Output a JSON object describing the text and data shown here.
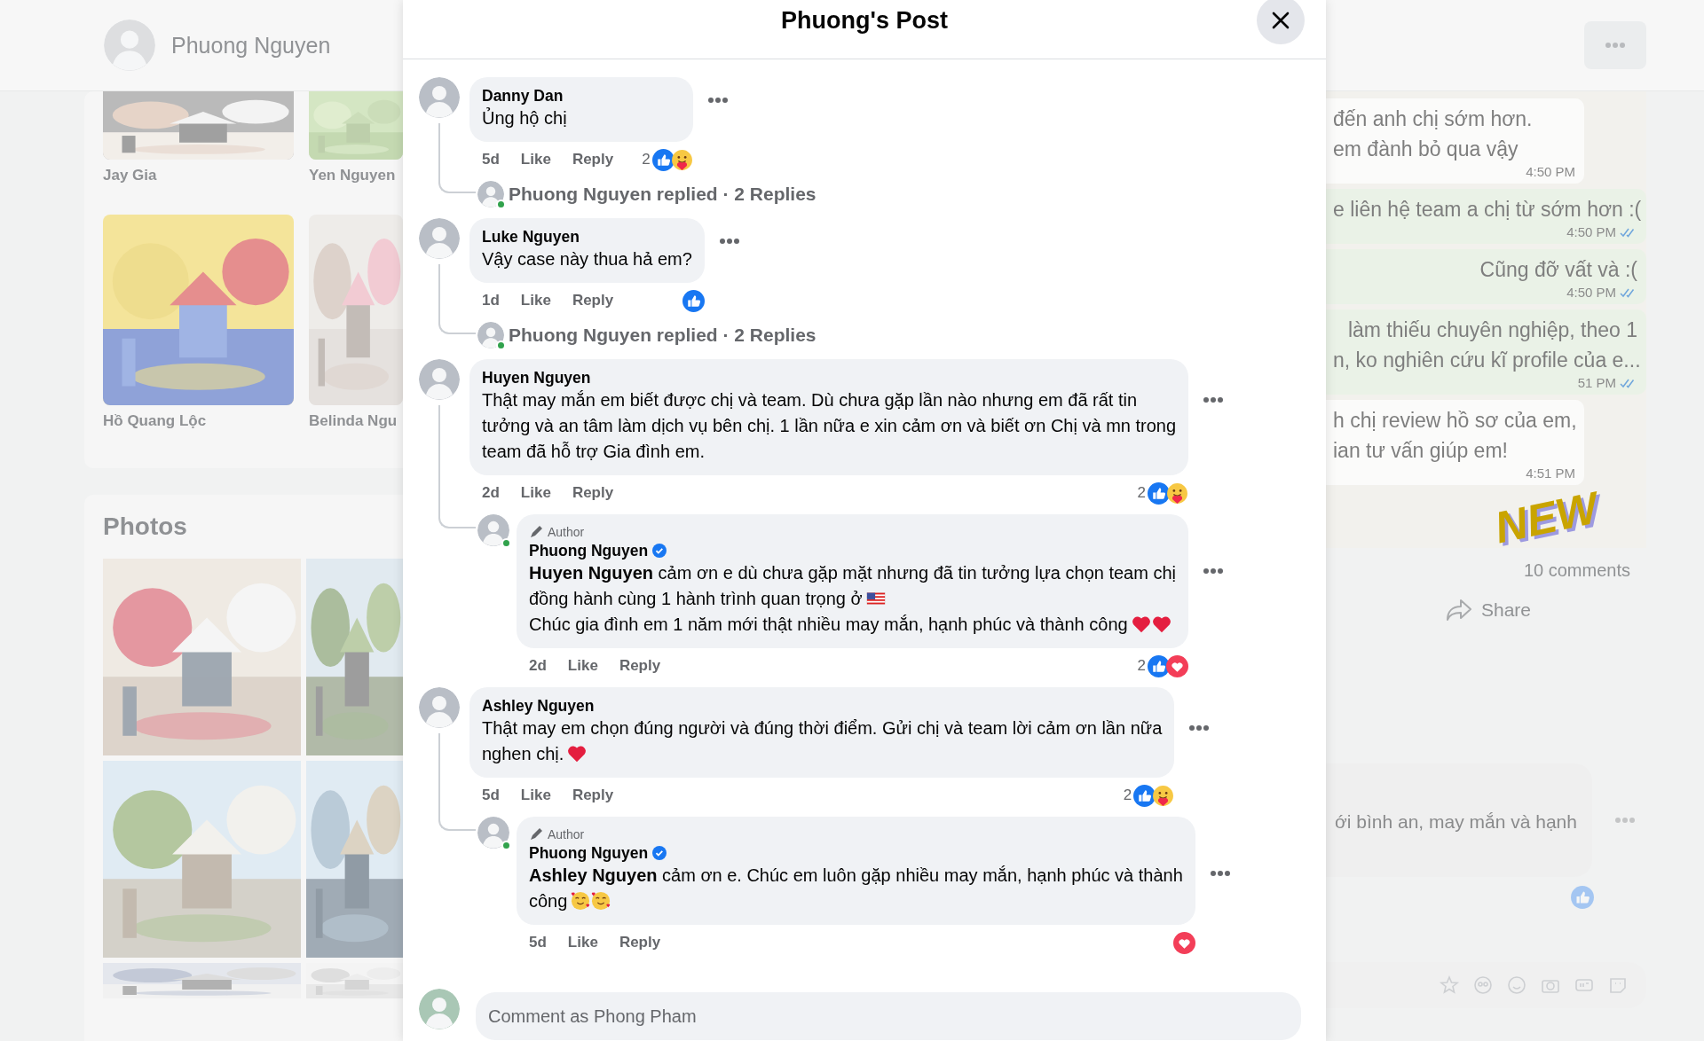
{
  "background": {
    "profile_name": "Phuong Nguyen",
    "friends": [
      {
        "name": "Jay Gia"
      },
      {
        "name": "Yen Nguyen"
      },
      {
        "name": "Hồ Quang Lộc"
      },
      {
        "name": "Belinda Ngu"
      }
    ],
    "photos_title": "Photos",
    "post": {
      "chat": [
        {
          "kind": "incoming",
          "lines": [
            "đến anh chị sớm hơn.",
            "em đành bỏ qua vậy"
          ],
          "time": "4:50 PM"
        },
        {
          "kind": "outgoing",
          "lines": [
            "e liên hệ team a chị từ sớm hơn :("
          ],
          "time": "4:50 PM",
          "read": true
        },
        {
          "kind": "outgoing",
          "lines": [
            "Cũng đỡ vất và :("
          ],
          "time": "4:50 PM",
          "read": true
        },
        {
          "kind": "outgoing",
          "lines": [
            "làm thiếu chuyên nghiệp, theo 1",
            "n, ko nghiên cứu kĩ profile của e..."
          ],
          "time": "51 PM",
          "read": true
        },
        {
          "kind": "incoming",
          "lines": [
            "h chị review hồ sơ của em,",
            "ian tư vấn giúp em!"
          ],
          "time": "4:51 PM"
        }
      ],
      "sticker": "NEW",
      "comment_count": "10 comments",
      "share": "Share",
      "comment_text": "ới bình an, may mắn và hạnh"
    }
  },
  "dialog": {
    "title": "Phuong's Post",
    "comments": [
      {
        "author": "Danny Dan",
        "lines": [
          {
            "text": "Ủng hộ chị"
          }
        ],
        "time": "5d",
        "like": "Like",
        "reply": "Reply",
        "reactions": {
          "count": "2",
          "items": [
            {
              "kind": "like"
            },
            {
              "kind": "care"
            }
          ]
        },
        "replied": {
          "text": "Phuong Nguyen replied · 2 Replies",
          "online": true
        }
      },
      {
        "author": "Luke Nguyen",
        "lines": [
          {
            "text": "Vậy case này thua hả em?"
          }
        ],
        "time": "1d",
        "like": "Like",
        "reply": "Reply",
        "reactions": {
          "items": [
            {
              "kind": "like"
            }
          ]
        },
        "replied": {
          "text": "Phuong Nguyen replied · 2 Replies",
          "online": true
        }
      },
      {
        "author": "Huyen Nguyen",
        "lines": [
          {
            "text": "Thật may mắn em biết được chị và team. Dù chưa gặp lần nào nhưng em đã rất tin"
          },
          {
            "text": "tưởng và an tâm làm dịch vụ bên chị. 1 lần nữa e xin cảm ơn và biết ơn Chị và mn trong"
          },
          {
            "text": "team đã hỗ trợ Gia đình em."
          }
        ],
        "time": "2d",
        "like": "Like",
        "reply": "Reply",
        "reactions": {
          "count": "2",
          "items": [
            {
              "kind": "like"
            },
            {
              "kind": "care"
            }
          ]
        },
        "replies": [
          {
            "badge": "Author",
            "author": "Phuong Nguyen",
            "verified": true,
            "online": true,
            "lines": [
              {
                "text": "**Huyen Nguyen** cảm ơn e dù chưa gặp mặt nhưng đã tin tưởng lựa chọn team chị"
              },
              {
                "text": "đồng hành cùng 1 hành trình quan trọng ở",
                "emojis": [
                  {
                    "kind": "flag"
                  }
                ]
              },
              {
                "text": "Chúc gia đình em 1 năm mới thật nhiều may mắn, hạnh phúc và thành công",
                "emojis": [
                  {
                    "kind": "heart"
                  },
                  {
                    "kind": "heart"
                  }
                ]
              }
            ],
            "time": "2d",
            "like": "Like",
            "reply": "Reply",
            "reactions": {
              "count": "2",
              "items": [
                {
                  "kind": "like"
                },
                {
                  "kind": "love"
                }
              ]
            }
          }
        ]
      },
      {
        "author": "Ashley Nguyen",
        "lines": [
          {
            "text": "Thật may em chọn đúng người và đúng thời điểm. Gửi chị và team lời cảm ơn lần nữa"
          },
          {
            "text": "nghen chị.",
            "emojis": [
              {
                "kind": "heart"
              }
            ]
          }
        ],
        "time": "5d",
        "like": "Like",
        "reply": "Reply",
        "reactions": {
          "count": "2",
          "items": [
            {
              "kind": "like"
            },
            {
              "kind": "care"
            }
          ]
        },
        "replies": [
          {
            "badge": "Author",
            "author": "Phuong Nguyen",
            "verified": true,
            "online": true,
            "lines": [
              {
                "text": "**Ashley Nguyen** cảm ơn e. Chúc em luôn gặp nhiều may mắn, hạnh phúc và thành"
              },
              {
                "text": "công",
                "emojis": [
                  {
                    "kind": "blush"
                  },
                  {
                    "kind": "blush"
                  }
                ]
              }
            ],
            "time": "5d",
            "like": "Like",
            "reply": "Reply",
            "reactions": {
              "items": [
                {
                  "kind": "love"
                }
              ]
            }
          }
        ]
      }
    ],
    "composer": {
      "placeholder": "Comment as Phong Pham"
    }
  }
}
